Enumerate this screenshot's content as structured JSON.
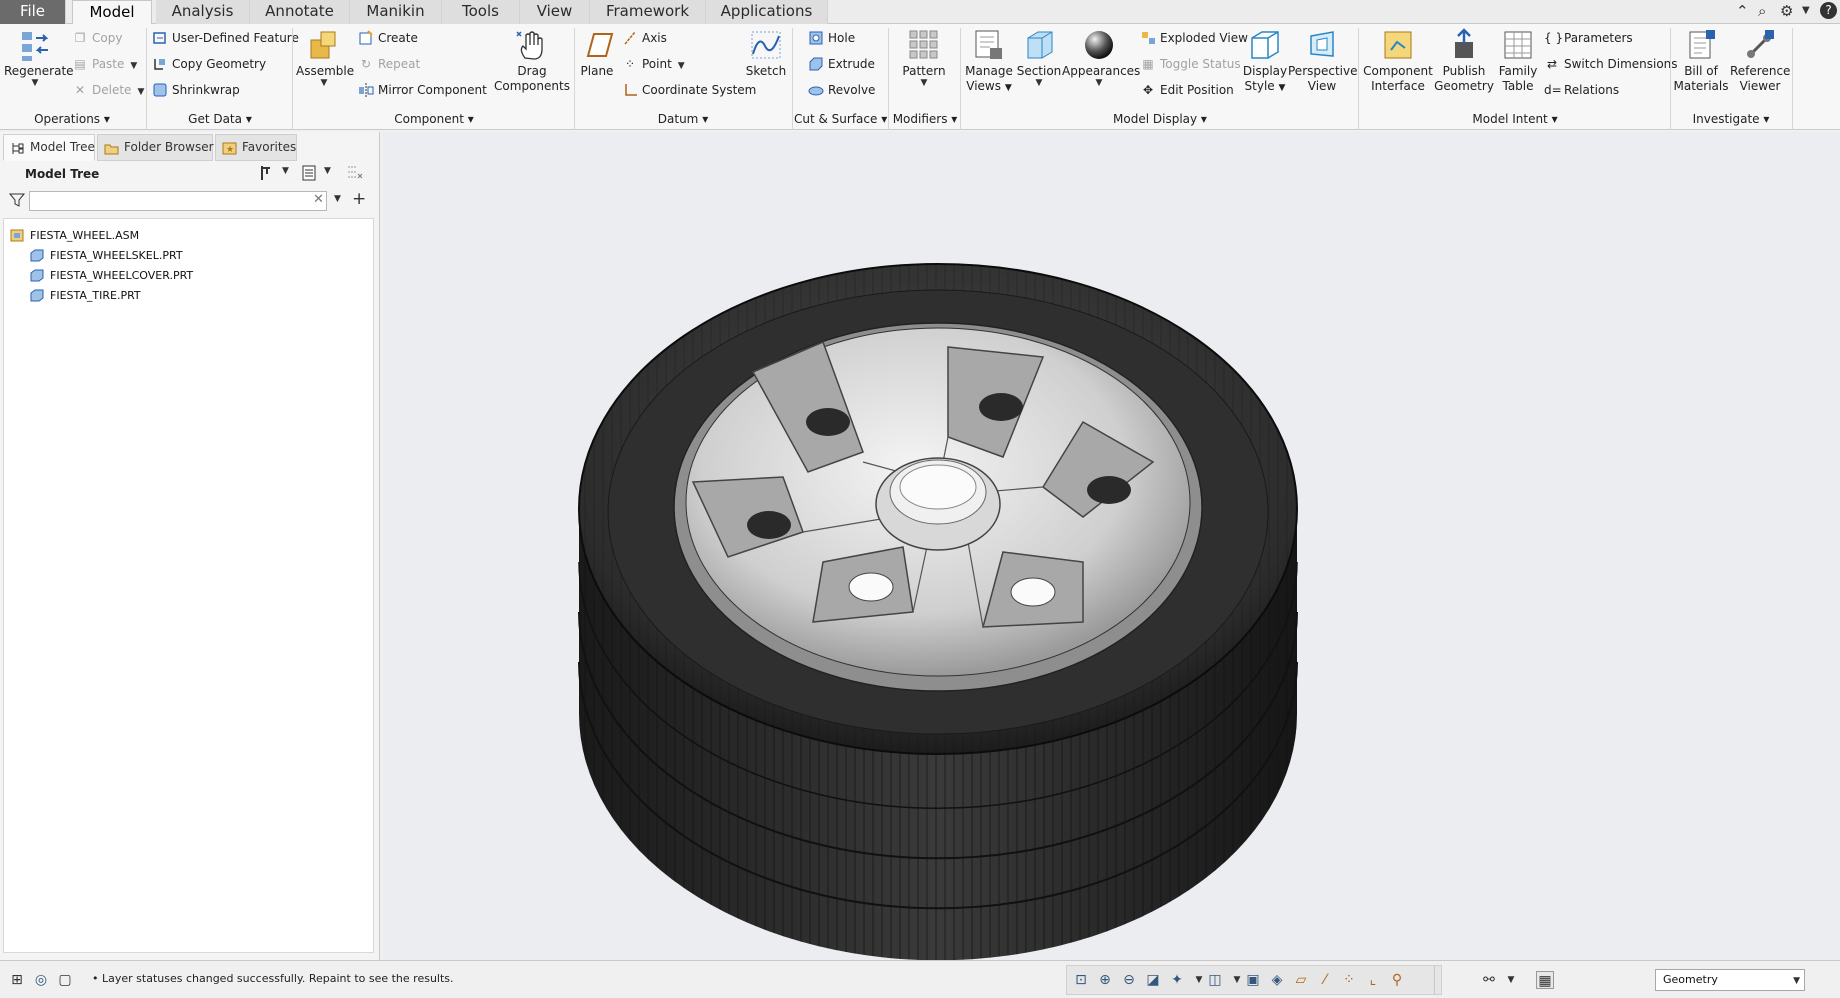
{
  "tabs": [
    {
      "label": "File"
    },
    {
      "label": "Model"
    },
    {
      "label": "Analysis"
    },
    {
      "label": "Annotate"
    },
    {
      "label": "Manikin"
    },
    {
      "label": "Tools"
    },
    {
      "label": "View"
    },
    {
      "label": "Framework"
    },
    {
      "label": "Applications"
    }
  ],
  "ribbon": {
    "operations": {
      "title": "Operations",
      "regenerate": "Regenerate",
      "copy": "Copy",
      "paste": "Paste",
      "delete": "Delete"
    },
    "getdata": {
      "title": "Get Data",
      "udf": "User-Defined Feature",
      "copy_geometry": "Copy Geometry",
      "shrinkwrap": "Shrinkwrap"
    },
    "component": {
      "title": "Component",
      "assemble": "Assemble",
      "create": "Create",
      "repeat": "Repeat",
      "mirror": "Mirror Component",
      "drag1": "Drag",
      "drag2": "Components"
    },
    "datum": {
      "title": "Datum",
      "plane": "Plane",
      "axis": "Axis",
      "point": "Point",
      "csys": "Coordinate System",
      "sketch": "Sketch"
    },
    "cutsurface": {
      "title": "Cut & Surface",
      "hole": "Hole",
      "extrude": "Extrude",
      "revolve": "Revolve"
    },
    "modifiers": {
      "title": "Modifiers",
      "pattern": "Pattern"
    },
    "modeldisplay": {
      "title": "Model Display",
      "manage1": "Manage",
      "manage2": "Views",
      "section": "Section",
      "appearances": "Appearances",
      "exploded": "Exploded View",
      "toggle": "Toggle Status",
      "editpos": "Edit Position",
      "display1": "Display",
      "display2": "Style",
      "persp1": "Perspective",
      "persp2": "View"
    },
    "modelintent": {
      "title": "Model Intent",
      "ci1": "Component",
      "ci2": "Interface",
      "pg1": "Publish",
      "pg2": "Geometry",
      "ft1": "Family",
      "ft2": "Table",
      "parameters": "Parameters",
      "switch": "Switch Dimensions",
      "relations": "Relations"
    },
    "investigate": {
      "title": "Investigate",
      "bom1": "Bill of",
      "bom2": "Materials",
      "ref1": "Reference",
      "ref2": "Viewer"
    }
  },
  "panel": {
    "tabs": [
      {
        "label": "Model Tree"
      },
      {
        "label": "Folder Browser"
      },
      {
        "label": "Favorites"
      }
    ],
    "header": "Model Tree",
    "search_value": "",
    "tree": [
      {
        "label": "FIESTA_WHEEL.ASM",
        "type": "assembly"
      },
      {
        "label": "FIESTA_WHEELSKEL.PRT",
        "type": "part"
      },
      {
        "label": "FIESTA_WHEELCOVER.PRT",
        "type": "part"
      },
      {
        "label": "FIESTA_TIRE.PRT",
        "type": "part"
      }
    ]
  },
  "status": {
    "message": "Layer statuses changed successfully. Repaint to see the results.",
    "filter": "Geometry"
  },
  "colors": {
    "accent": "#3a78c4",
    "viewport": "#ebedf0",
    "tire": "#2a2a2a",
    "rim": "#d9d9d9"
  }
}
